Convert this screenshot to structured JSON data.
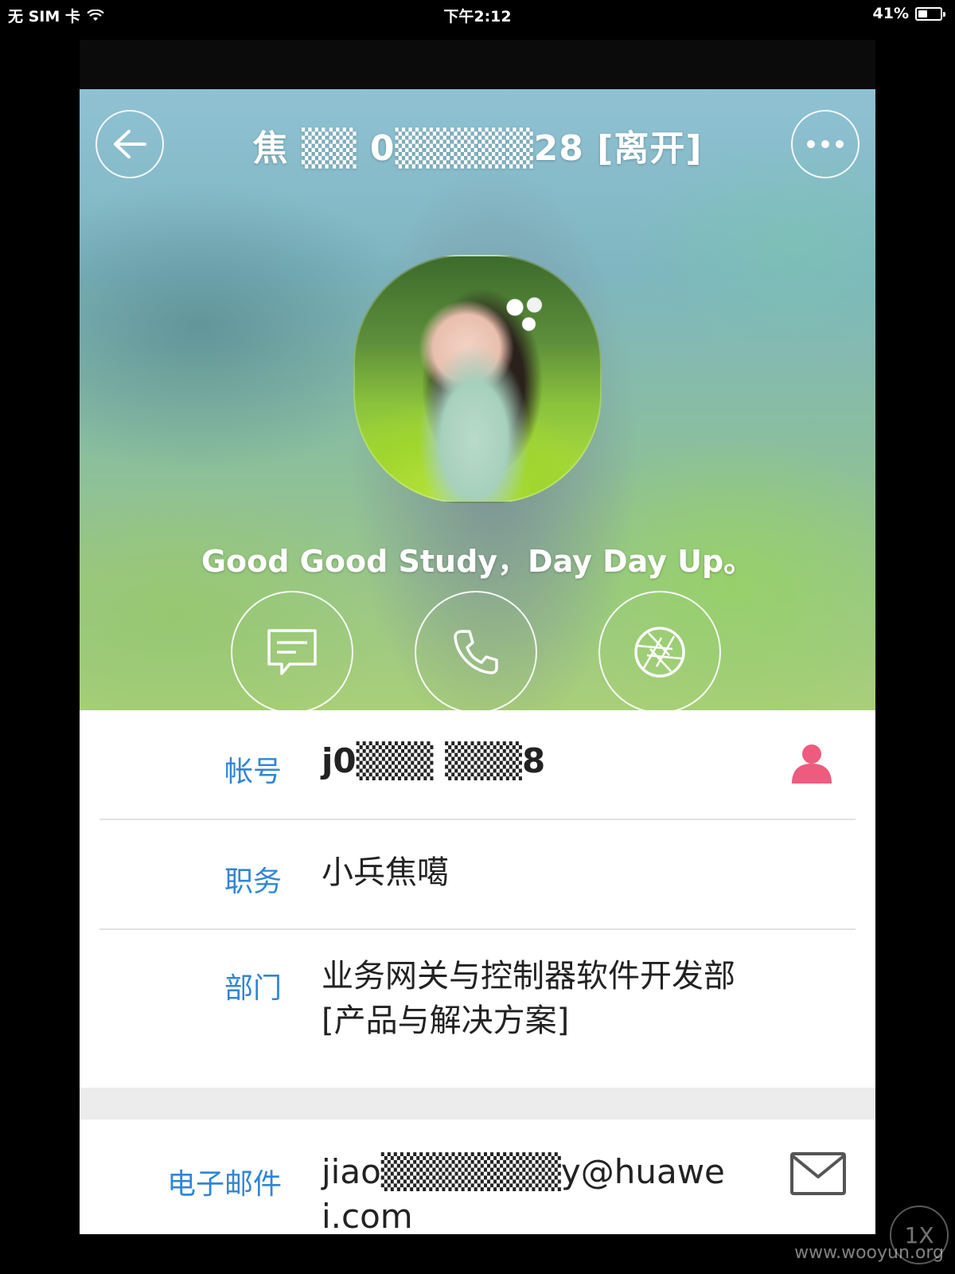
{
  "status_bar": {
    "carrier": "无 SIM 卡",
    "time": "下午2:12",
    "battery_pct": "41%",
    "battery_level": 0.41
  },
  "header": {
    "title": "焦 ▒▒ 0▒▒▒▒▒28 [离开]",
    "back_icon": "arrow-left-icon",
    "more_icon": "ellipsis-icon"
  },
  "profile": {
    "motto": "Good Good Study，Day Day Up。"
  },
  "actions": [
    {
      "icon": "message-icon"
    },
    {
      "icon": "phone-icon"
    },
    {
      "icon": "camera-aperture-icon"
    }
  ],
  "info": {
    "account": {
      "label": "帐号",
      "value": "j0▒▒▒ ▒▒▒8",
      "icon": "person-icon",
      "icon_color": "#ee5b7f"
    },
    "position": {
      "label": "职务",
      "value": "小兵焦噶"
    },
    "department": {
      "label": "部门",
      "value": "业务网关与控制器软件开发部 [产品与解决方案]"
    },
    "email": {
      "label": "电子邮件",
      "value": "jiao▒▒▒▒▒▒▒y@huawei.com",
      "icon": "mail-icon"
    }
  },
  "colors": {
    "label_blue": "#2f86d6",
    "section_gap": "#ececec"
  },
  "overlay": {
    "zoom_badge": "1X",
    "watermark": "www.wooyun.org"
  }
}
